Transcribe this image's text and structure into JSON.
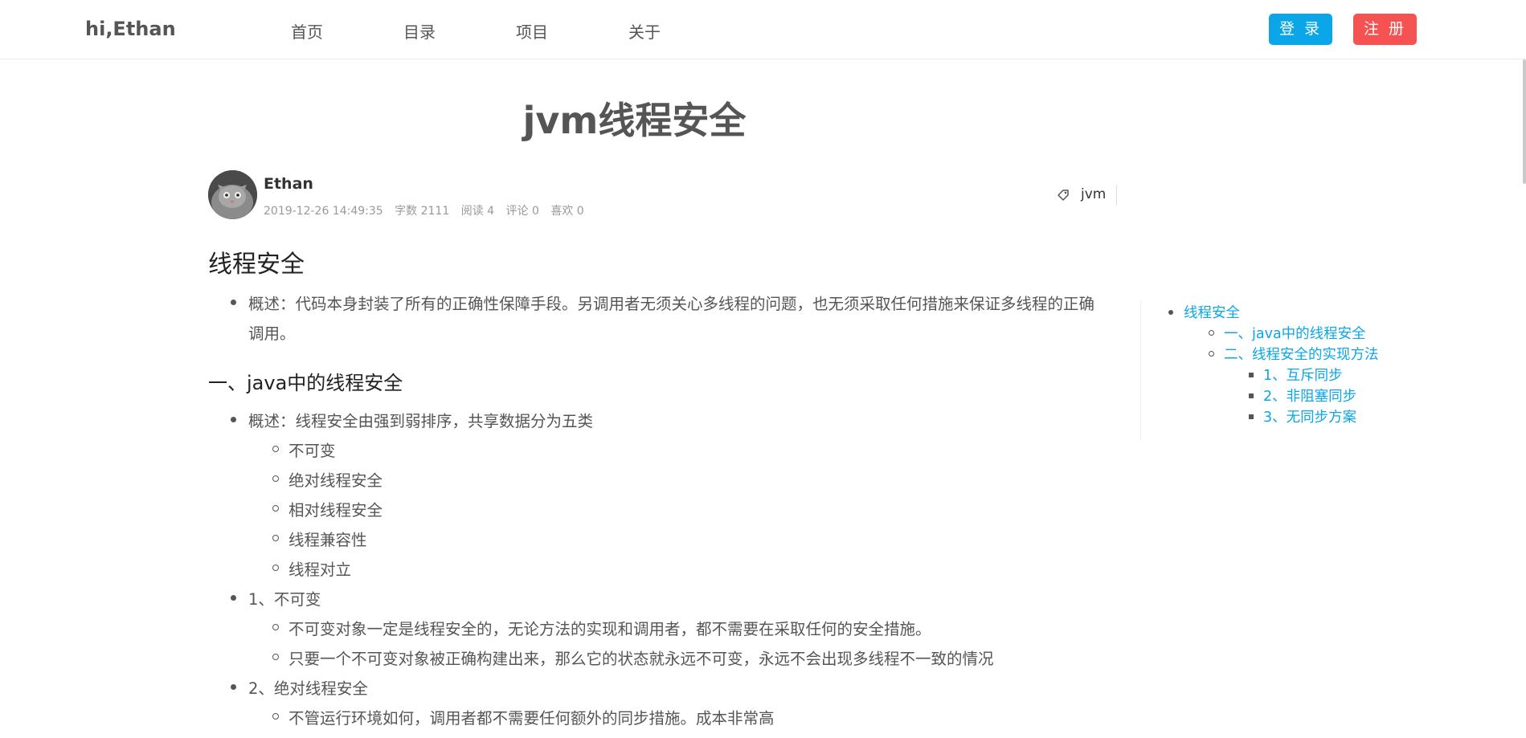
{
  "header": {
    "brand": "hi,Ethan",
    "nav": [
      "首页",
      "目录",
      "项目",
      "关于"
    ],
    "login": "登 录",
    "register": "注 册"
  },
  "post": {
    "title": "jvm线程安全",
    "author": "Ethan",
    "date": "2019-12-26 14:49:35",
    "words": "字数 2111",
    "reads": "阅读 4",
    "comments": "评论 0",
    "likes": "喜欢 0",
    "tag": "jvm"
  },
  "content": {
    "h1": "线程安全",
    "intro_1": "概述：代码本身封装了所有的正确性保障手段。另调用者无须关心多线程的问题，也无须采取任何措施来保证多线程的正确",
    "intro_2": "调用。",
    "h2_java": "一、java中的线程安全",
    "overview": "概述：线程安全由强到弱排序，共享数据分为五类",
    "categories": [
      "不可变",
      "绝对线程安全",
      "相对线程安全",
      "线程兼容性",
      "线程对立"
    ],
    "s1_title": "1、不可变",
    "s1_items": [
      "不可变对象一定是线程安全的，无论方法的实现和调用者，都不需要在采取任何的安全措施。",
      "只要一个不可变对象被正确构建出来，那么它的状态就永远不可变，永远不会出现多线程不一致的情况"
    ],
    "s2_title": "2、绝对线程安全",
    "s2_items": [
      "不管运行环境如何，调用者都不需要任何额外的同步措施。成本非常高"
    ]
  },
  "toc": {
    "root": "线程安全",
    "l2": [
      "一、java中的线程安全",
      "二、线程安全的实现方法"
    ],
    "l3": [
      "1、互斥同步",
      "2、非阻塞同步",
      "3、无同步方案"
    ]
  },
  "colors": {
    "accent": "#0aa6e8",
    "danger": "#f55252"
  },
  "icons": {
    "tag": "tag-icon",
    "avatar": "cat-avatar"
  }
}
